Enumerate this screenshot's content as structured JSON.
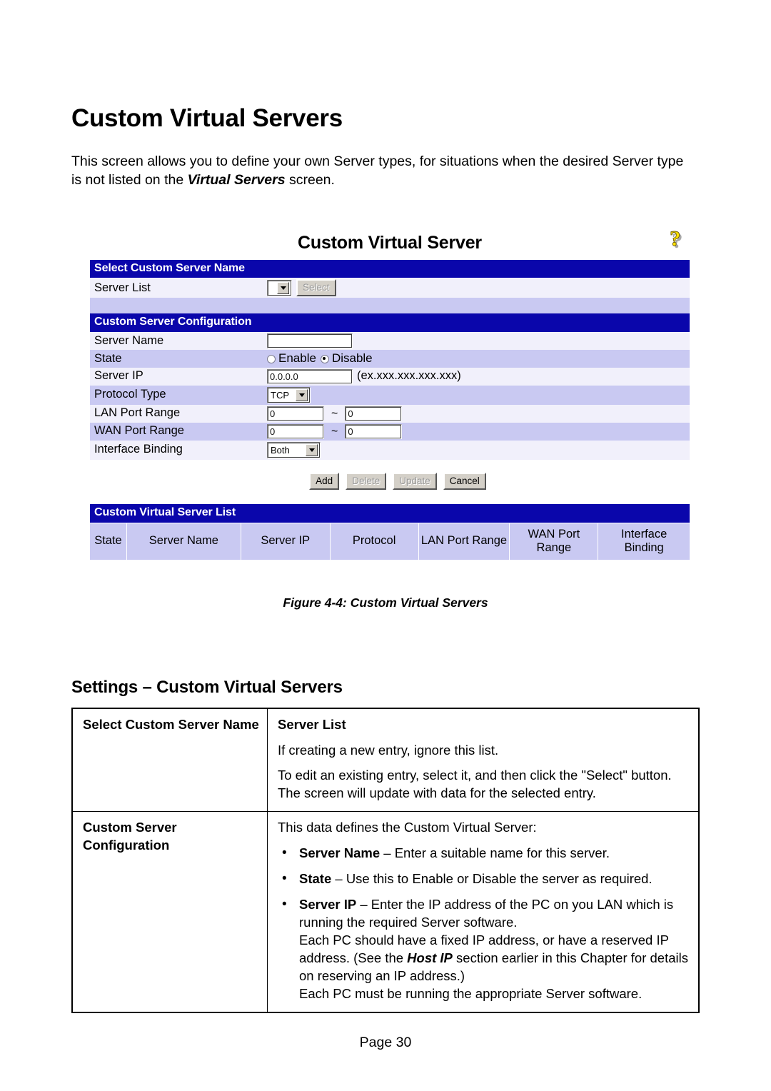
{
  "document": {
    "title": "Custom Virtual Servers",
    "intro_part1": "This screen allows you to define your own Server types, for situations when the desired Server type is not listed on the ",
    "intro_emphasis": "Virtual Servers",
    "intro_part2": " screen.",
    "page_footer": "Page 30"
  },
  "figure": {
    "caption": "Figure 4-4: Custom Virtual Servers",
    "help_icon": "question-mark-help-icon",
    "header_title": "Custom Virtual Server",
    "section_select": {
      "band": "Select Custom Server Name",
      "server_list_label": "Server List",
      "server_list_value": "",
      "select_button": "Select",
      "select_button_disabled": true
    },
    "section_config": {
      "band": "Custom Server Configuration",
      "fields": {
        "server_name_label": "Server Name",
        "server_name_value": "",
        "state_label": "State",
        "state_enable": "Enable",
        "state_disable": "Disable",
        "state_selected": "Disable",
        "server_ip_label": "Server IP",
        "server_ip_value": "0.0.0.0",
        "server_ip_hint": "(ex.xxx.xxx.xxx.xxx)",
        "protocol_type_label": "Protocol Type",
        "protocol_type_value": "TCP",
        "lan_port_range_label": "LAN Port Range",
        "lan_port_start": "0",
        "lan_port_end": "0",
        "wan_port_range_label": "WAN Port Range",
        "wan_port_start": "0",
        "wan_port_end": "0",
        "range_separator": "~",
        "interface_binding_label": "Interface Binding",
        "interface_binding_value": "Both"
      },
      "buttons": [
        {
          "label": "Add",
          "disabled": false
        },
        {
          "label": "Delete",
          "disabled": true
        },
        {
          "label": "Update",
          "disabled": true
        },
        {
          "label": "Cancel",
          "disabled": false
        }
      ]
    },
    "section_list": {
      "band": "Custom Virtual Server List",
      "columns": [
        "State",
        "Server Name",
        "Server IP",
        "Protocol",
        "LAN Port Range",
        "WAN Port\nRange",
        "Interface\nBinding"
      ],
      "rows": []
    },
    "colors": {
      "band_blue": "#0a06ab",
      "row_light": "#f1f0fb",
      "row_shade": "#c9c9f2",
      "help_icon_yellow": "#ffe100"
    }
  },
  "settings": {
    "heading": "Settings – Custom Virtual Servers",
    "rows": [
      {
        "key": "Select Custom Server Name",
        "value_title": "Server List",
        "paragraphs": [
          "If creating a new entry, ignore this list.",
          "To edit an existing entry, select it, and then click the \"Select\" button. The screen will update with data for the selected entry."
        ]
      },
      {
        "key": "Custom Server Configuration",
        "value_title": "This data defines the Custom Virtual Server:",
        "bullets": [
          {
            "term": "Server Name",
            "text": " – Enter a suitable name for this server."
          },
          {
            "term": "State",
            "text": " – Use this to Enable or Disable the server as required."
          },
          {
            "term": "Server IP",
            "text": " – Enter the IP address of the PC on you LAN which is running the required Server software.",
            "extra_1": "Each PC should have a fixed IP address, or have a reserved IP address. (See the ",
            "extra_em": "Host IP",
            "extra_2": " section earlier in this Chapter for details on reserving an IP address.)",
            "extra_3": "Each PC must be running the appropriate Server software."
          }
        ]
      }
    ]
  }
}
